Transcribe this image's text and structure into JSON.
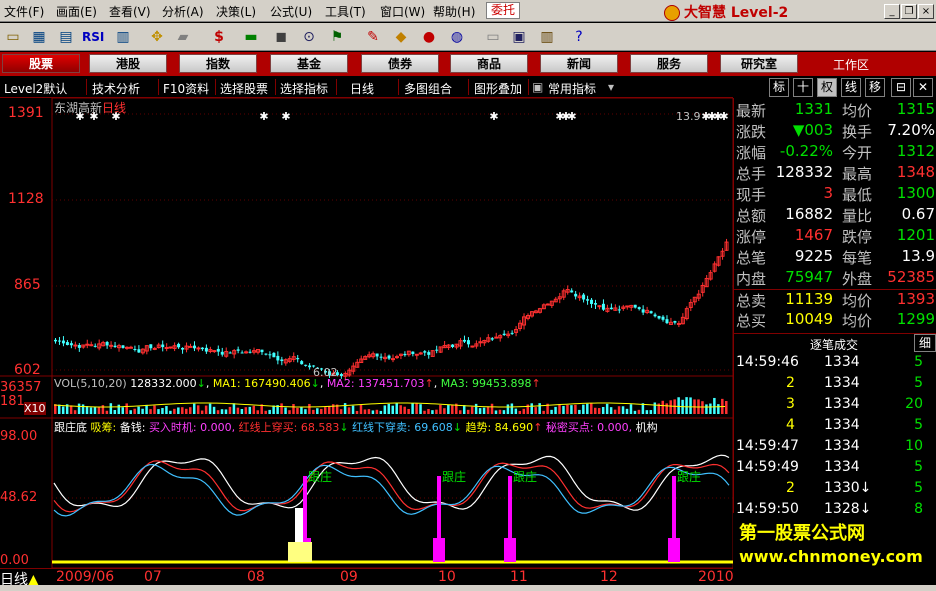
{
  "menu": {
    "items": [
      "文件(F)",
      "画面(E)",
      "查看(V)",
      "分析(A)",
      "决策(L)",
      "公式(U)",
      "工具(T)",
      "窗口(W)",
      "帮助(H)"
    ],
    "delegate": "委托",
    "brand": "大智慧 Level-2"
  },
  "nav": {
    "items": [
      "股票",
      "港股",
      "指数",
      "基金",
      "债券",
      "商品",
      "新闻",
      "服务",
      "研究室"
    ],
    "workarea": "工作区"
  },
  "subbar": {
    "items": [
      "Level2默认",
      "技术分析",
      "F10资料",
      "选择股票",
      "选择指标",
      "日线",
      "多图组合",
      "图形叠加",
      "常用指标"
    ]
  },
  "rtabs": [
    "标",
    "十",
    "权",
    "线",
    "移"
  ],
  "chart": {
    "title": "东湖高新",
    "period": "日线",
    "y_labels": [
      "1391",
      "1128",
      "865",
      "602"
    ],
    "max_label": "13.9",
    "min_label": "6.02",
    "vol_header": "VOL(5,10,20)",
    "vol_value": "128332.000",
    "ma1": "MA1: 167490.406",
    "ma2": "MA2: 137451.703",
    "ma3": "MA3: 99453.898",
    "vol_left": [
      "36357",
      "181",
      "X10"
    ],
    "ind_name": "跟庄底",
    "ind_items": [
      "吸筹:",
      "备钱:",
      "买入时机: 0.000,",
      "红线上穿买: 68.583",
      "红线下穿卖: 69.608",
      "趋势: 84.690",
      "秘密买点: 0.000,",
      "机构"
    ],
    "ind_y": [
      "98.00",
      "48.62",
      "0.00"
    ],
    "follow_label": "跟庄",
    "dates": [
      "2009/06",
      "07",
      "08",
      "09",
      "10",
      "11",
      "12",
      "2010"
    ],
    "period_short": "日线"
  },
  "quote": [
    {
      "l1": "最新",
      "v1": "1331",
      "c1": "green",
      "l2": "均价",
      "v2": "1315",
      "c2": "green"
    },
    {
      "l1": "涨跌",
      "v1": "▼003",
      "c1": "green",
      "l2": "换手",
      "v2": "7.20%",
      "c2": "white"
    },
    {
      "l1": "涨幅",
      "v1": "-0.22%",
      "c1": "green",
      "l2": "今开",
      "v2": "1312",
      "c2": "green"
    },
    {
      "l1": "总手",
      "v1": "128332",
      "c1": "white",
      "l2": "最高",
      "v2": "1348",
      "c2": "red"
    },
    {
      "l1": "现手",
      "v1": "3",
      "c1": "red",
      "l2": "最低",
      "v2": "1300",
      "c2": "green"
    },
    {
      "l1": "总额",
      "v1": "16882",
      "c1": "white",
      "l2": "量比",
      "v2": "0.67",
      "c2": "white"
    },
    {
      "l1": "涨停",
      "v1": "1467",
      "c1": "red",
      "l2": "跌停",
      "v2": "1201",
      "c2": "green"
    },
    {
      "l1": "总笔",
      "v1": "9225",
      "c1": "white",
      "l2": "每笔",
      "v2": "13.9",
      "c2": "white"
    },
    {
      "l1": "内盘",
      "v1": "75947",
      "c1": "green",
      "l2": "外盘",
      "v2": "52385",
      "c2": "red"
    },
    {
      "l1": "总卖",
      "v1": "11139",
      "c1": "yellow",
      "l2": "均价",
      "v2": "1393",
      "c2": "red"
    },
    {
      "l1": "总买",
      "v1": "10049",
      "c1": "yellow",
      "l2": "均价",
      "v2": "1299",
      "c2": "green"
    }
  ],
  "trades": {
    "header": "逐笔成交",
    "tab": "细",
    "rows": [
      {
        "t": "14:59:46",
        "p": "1334",
        "v": "5",
        "c": "green"
      },
      {
        "t": "2",
        "p": "1334",
        "v": "5",
        "c": "green"
      },
      {
        "t": "3",
        "p": "1334",
        "v": "20",
        "c": "green"
      },
      {
        "t": "4",
        "p": "1334",
        "v": "5",
        "c": "green"
      },
      {
        "t": "14:59:47",
        "p": "1334",
        "v": "10",
        "c": "green"
      },
      {
        "t": "14:59:49",
        "p": "1334",
        "v": "5",
        "c": "green"
      },
      {
        "t": "2",
        "p": "1330↓",
        "v": "5",
        "c": "green"
      },
      {
        "t": "14:59:50",
        "p": "1328↓",
        "v": "8",
        "c": "green"
      }
    ]
  },
  "watermark": {
    "line1": "第一股票公式网",
    "line2": "www.chnmoney.com"
  }
}
